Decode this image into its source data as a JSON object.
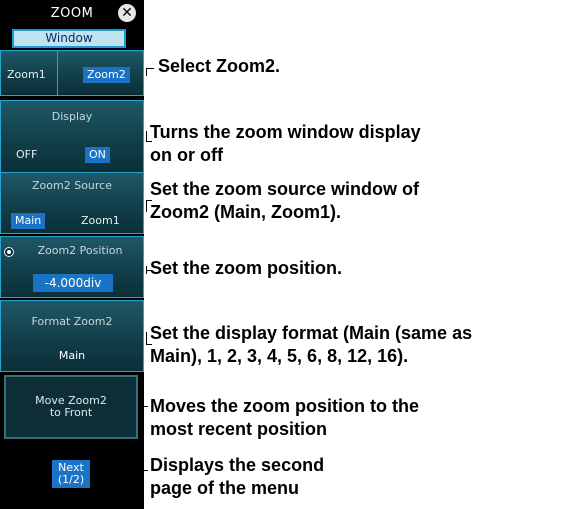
{
  "menu": {
    "title": "ZOOM",
    "window_tab": "Window",
    "zoom_select": {
      "options": [
        "Zoom1",
        "Zoom2"
      ],
      "selected": "Zoom2"
    },
    "display": {
      "label": "Display",
      "off": "OFF",
      "on": "ON",
      "selected": "ON"
    },
    "source": {
      "label": "Zoom2 Source",
      "options": [
        "Main",
        "Zoom1"
      ],
      "selected": "Main"
    },
    "position": {
      "label": "Zoom2 Position",
      "value": "-4.000div"
    },
    "format": {
      "label": "Format Zoom2",
      "value": "Main"
    },
    "move_button": {
      "line1": "Move Zoom2",
      "line2": "to Front"
    },
    "next_button": {
      "line1": "Next",
      "line2": "(1/2)"
    }
  },
  "callouts": {
    "select_zoom2": "Select Zoom2.",
    "display_1": "Turns the zoom window display",
    "display_2": "on or off",
    "source_1": "Set the zoom source window of",
    "source_2": "Zoom2 (Main, Zoom1).",
    "position": "Set the zoom position.",
    "format_1": "Set the display format (Main (same as",
    "format_2": "Main), 1, 2, 3, 4, 5, 6, 8, 12, 16).",
    "move_1": "Moves the zoom position to the",
    "move_2": "most recent position",
    "next_1": "Displays the second",
    "next_2": "page of the menu"
  },
  "colors": {
    "panel_bg": "#000000",
    "selected_blue": "#1a73c4",
    "panel_border": "#2aa3cc",
    "window_tab_bg": "#bfe3ef"
  }
}
